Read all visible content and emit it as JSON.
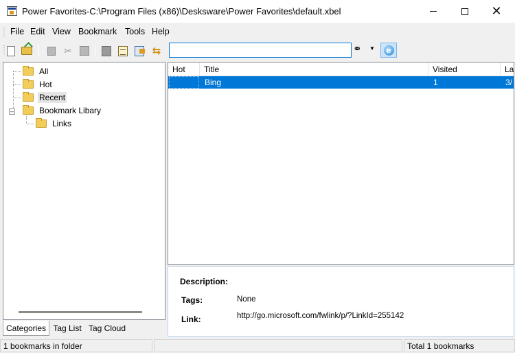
{
  "window": {
    "title": "Power Favorites-C:\\Program Files (x86)\\Desksware\\Power Favorites\\default.xbel"
  },
  "menu": [
    "File",
    "Edit",
    "View",
    "Bookmark",
    "Tools",
    "Help"
  ],
  "toolbar": {
    "buttons": [
      "new-icon",
      "open-icon",
      "copy-icon",
      "cut-icon",
      "paste-icon",
      "delete-icon",
      "properties-icon",
      "open-link-icon",
      "move-icon"
    ],
    "search_value": "",
    "search_icon": "binoculars-icon",
    "browser_icon": "internet-explorer-icon"
  },
  "tree": {
    "items": [
      {
        "label": "All"
      },
      {
        "label": "Hot"
      },
      {
        "label": "Recent"
      },
      {
        "label": "Bookmark Libary"
      },
      {
        "label": "Links"
      }
    ]
  },
  "tabs": [
    "Categories",
    "Tag List",
    "Tag Cloud"
  ],
  "list": {
    "columns": [
      "Hot",
      "Title",
      "Visited",
      "La"
    ],
    "rows": [
      {
        "hot": "",
        "title": "Bing",
        "visited": "1",
        "last": "3/"
      }
    ]
  },
  "details": {
    "description_label": "Description:",
    "tags_label": "Tags:",
    "tags_value": "None",
    "link_label": "Link:",
    "link_value": "http://go.microsoft.com/fwlink/p/?LinkId=255142"
  },
  "status": {
    "left": "1 bookmarks in folder",
    "middle": "",
    "right": "Total 1 bookmarks"
  },
  "colors": {
    "selection": "#0078d7",
    "folder": "#f3cd59"
  }
}
